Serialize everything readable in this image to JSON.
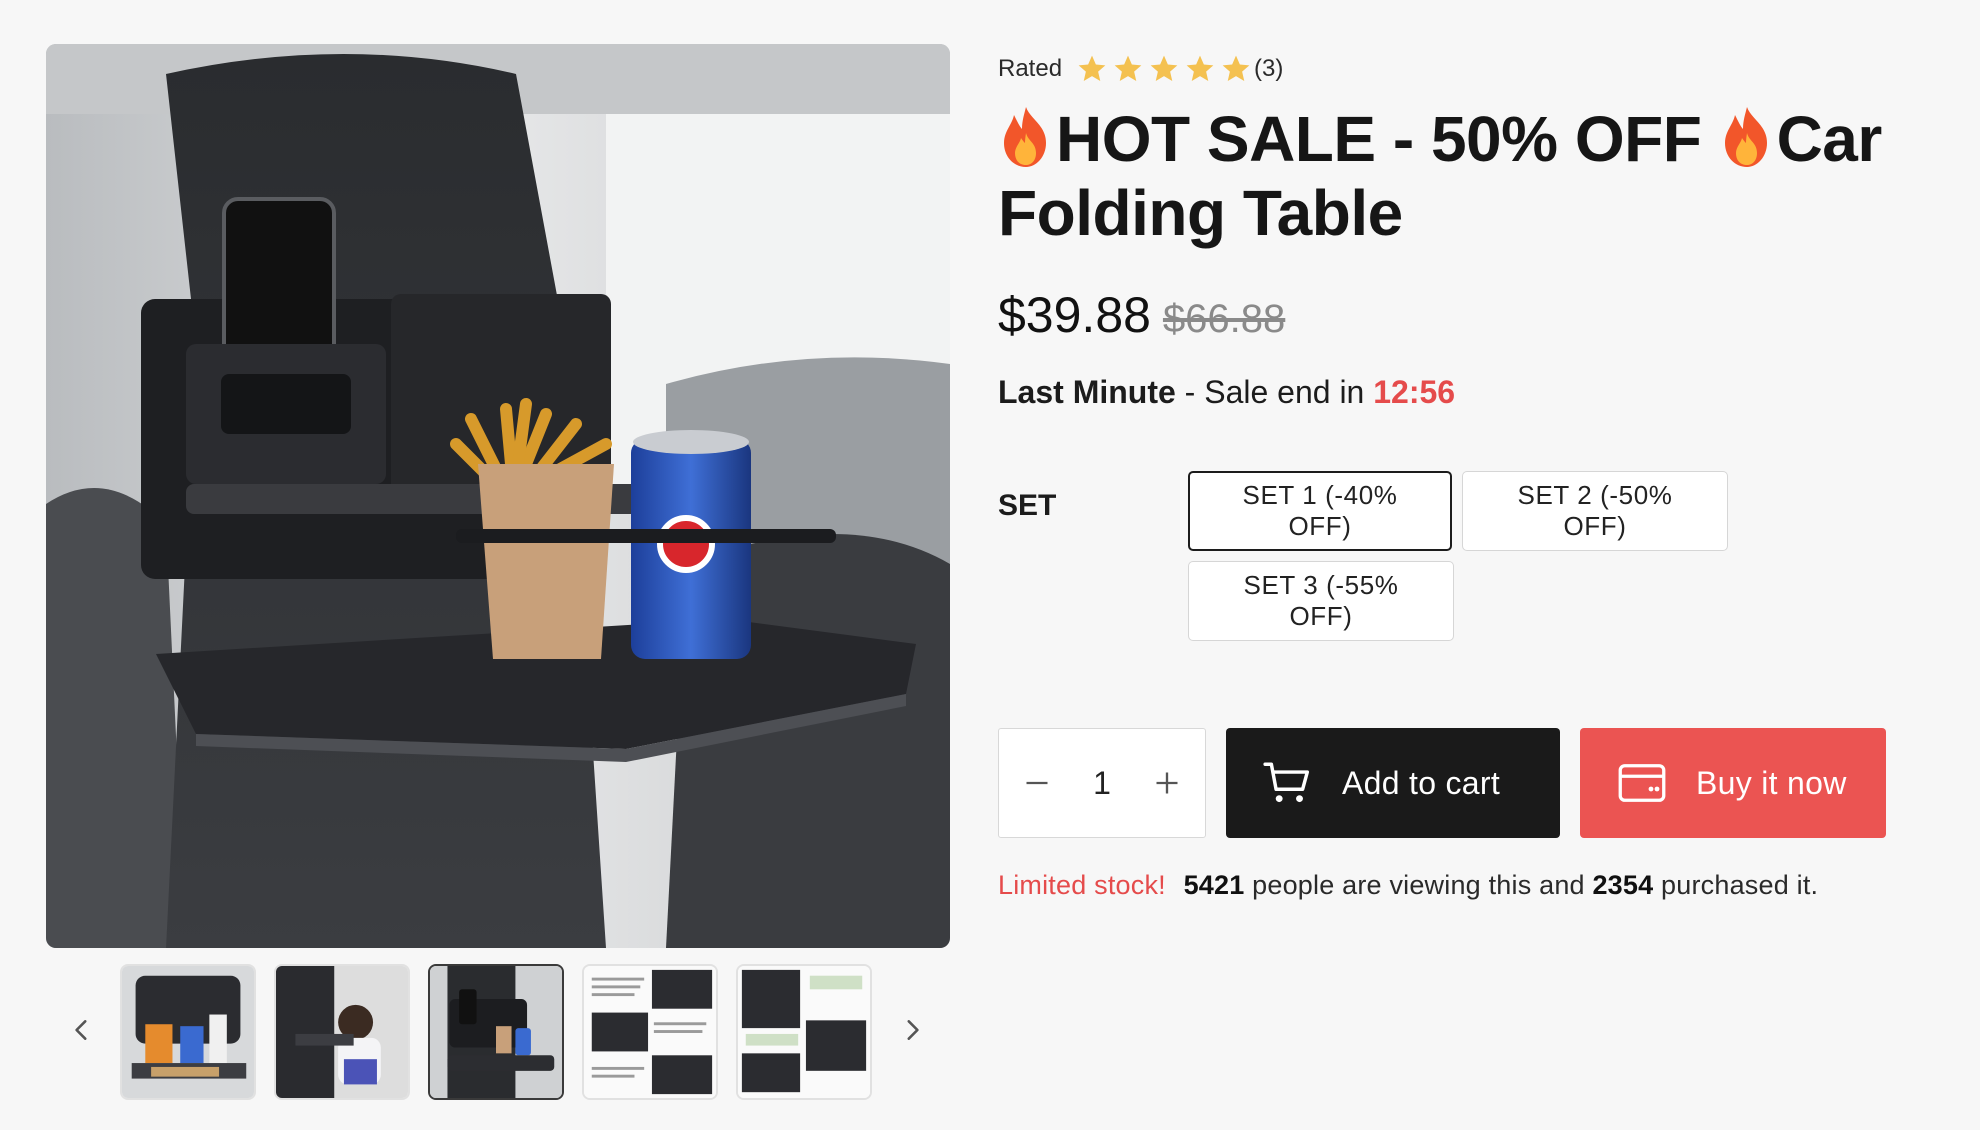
{
  "gallery": {
    "main_image_alt": "Car folding table with phone, fries and soda can",
    "thumbnails": [
      {
        "alt": "Organizer with cups and tissues",
        "active": false
      },
      {
        "alt": "Child using car table",
        "active": false
      },
      {
        "alt": "Tray with phone and fries",
        "active": true
      },
      {
        "alt": "Installation instructions",
        "active": false
      },
      {
        "alt": "Fold steps",
        "active": false
      }
    ]
  },
  "product": {
    "rating_label": "Rated",
    "rating_value": 5,
    "rating_count": "(3)",
    "title_part1": "HOT SALE - 50% OFF ",
    "title_part2": "Car Folding Table",
    "price": "$39.88",
    "compare_price": "$66.88",
    "sale_prefix": "Last Minute",
    "sale_middle": " - Sale end in ",
    "sale_timer": "12:56",
    "set_label": "SET",
    "variants": [
      {
        "label": "SET 1 (-40% OFF)",
        "selected": true
      },
      {
        "label": "SET 2 (-50% OFF)",
        "selected": false
      },
      {
        "label": "SET 3 (-55% OFF)",
        "selected": false
      }
    ],
    "quantity": "1",
    "add_to_cart": "Add to cart",
    "buy_now": "Buy it now",
    "stock_warning": "Limited stock!",
    "viewers": "5421",
    "viewers_text": " people are viewing this and ",
    "purchased": "2354",
    "purchased_text": " purchased it."
  },
  "colors": {
    "accent_red": "#eb5452",
    "timer_red": "#e54b4b",
    "star": "#f4c150",
    "dark_button": "#1a1a1a"
  },
  "icons": [
    "fire-icon",
    "star-icon",
    "cart-icon",
    "credit-card-icon",
    "minus-icon",
    "plus-icon",
    "chevron-left-icon",
    "chevron-right-icon"
  ]
}
